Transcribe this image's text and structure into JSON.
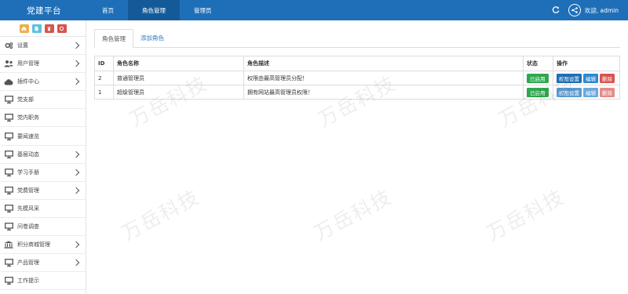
{
  "app": {
    "title": "党建平台"
  },
  "nav": [
    "首页",
    "角色管理",
    "管理员"
  ],
  "user": {
    "greeting": "欢迎, admin"
  },
  "sidebar": {
    "items": [
      {
        "label": "设置",
        "icon": "gears-icon",
        "has_children": true
      },
      {
        "label": "用户管理",
        "icon": "users-icon",
        "has_children": true
      },
      {
        "label": "插件中心",
        "icon": "cloud-icon",
        "has_children": true
      },
      {
        "label": "党支部",
        "icon": "desktop-icon",
        "has_children": false
      },
      {
        "label": "党内职务",
        "icon": "desktop-icon",
        "has_children": false
      },
      {
        "label": "要闻速览",
        "icon": "desktop-icon",
        "has_children": false
      },
      {
        "label": "基层动态",
        "icon": "desktop-icon",
        "has_children": true
      },
      {
        "label": "学习手册",
        "icon": "desktop-icon",
        "has_children": true
      },
      {
        "label": "党费管理",
        "icon": "desktop-icon",
        "has_children": true
      },
      {
        "label": "先模风采",
        "icon": "desktop-icon",
        "has_children": false
      },
      {
        "label": "问卷调查",
        "icon": "desktop-icon",
        "has_children": false
      },
      {
        "label": "积分商城管理",
        "icon": "bank-icon",
        "has_children": true
      },
      {
        "label": "产品管理",
        "icon": "desktop-icon",
        "has_children": true
      },
      {
        "label": "工作提示",
        "icon": "desktop-icon",
        "has_children": false
      }
    ]
  },
  "shortcut_colors": [
    "#f0ad4e",
    "#5bc0de",
    "#d9534f",
    "#d9534f"
  ],
  "tabs": [
    "角色管理",
    "添加角色"
  ],
  "table": {
    "headers": [
      "ID",
      "角色名称",
      "角色描述",
      "状态",
      "操作"
    ],
    "rows": [
      {
        "id": "2",
        "name": "普通管理员",
        "desc": "权限由最高管理员分配！",
        "status": "已启用",
        "actions": [
          "权限设置",
          "编辑",
          "删除"
        ]
      },
      {
        "id": "1",
        "name": "超级管理员",
        "desc": "拥有网站最高管理员权限！",
        "status": "已启用",
        "actions": [
          "权限设置",
          "编辑",
          "删除"
        ]
      }
    ]
  },
  "watermark": "万岳科技"
}
